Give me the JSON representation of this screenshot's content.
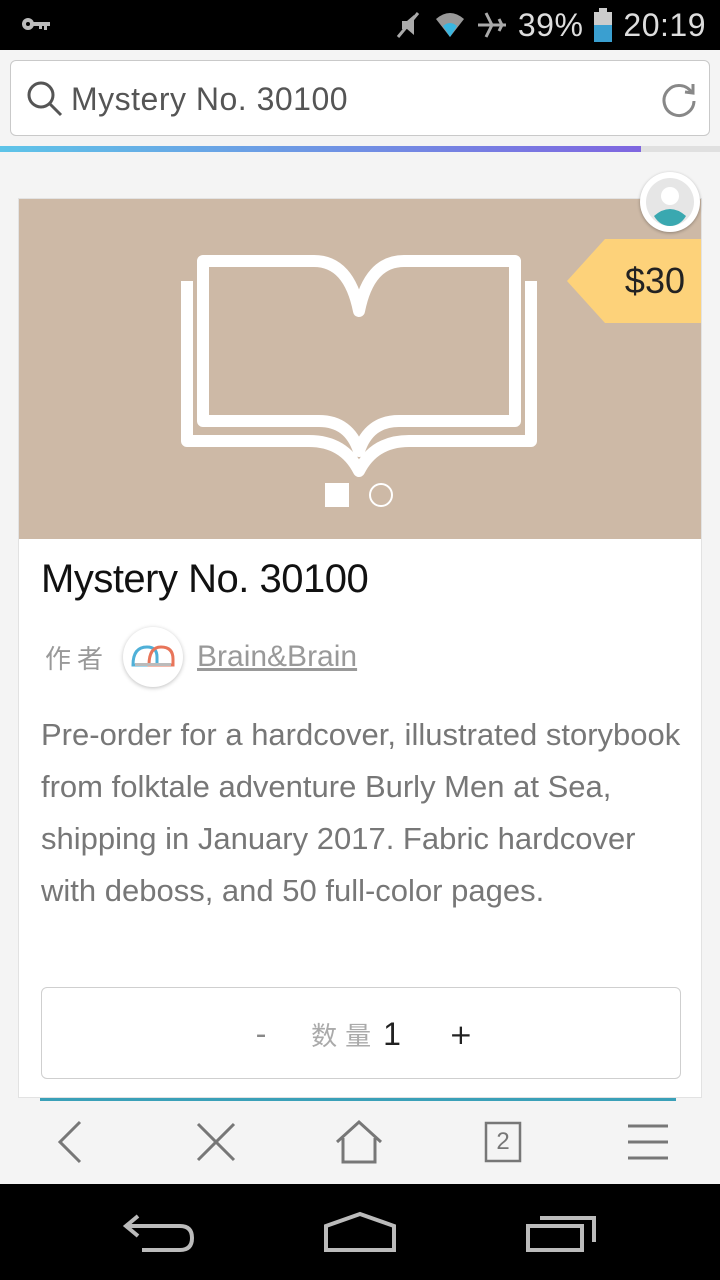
{
  "status_bar": {
    "battery_percent": "39%",
    "time": "20:19",
    "icons": [
      "key-icon",
      "mute-icon",
      "wifi-icon",
      "airplane-icon",
      "battery-icon"
    ]
  },
  "search": {
    "query": "Mystery No. 30100",
    "load_progress": 0.89,
    "gradient": [
      "#5ec4e8",
      "#7f66e0"
    ]
  },
  "product": {
    "price": "$30",
    "price_tag_color": "#fdd27a",
    "hero_color": "#cdb9a6",
    "carousel": {
      "pages": 2,
      "active_index": 0
    },
    "title": "Mystery No. 30100",
    "author_label": "作者",
    "author_name": "Brain&Brain",
    "description": "Pre-order for a hardcover, illustrated storybook from folktale adventure Burly Men at Sea, shipping in January 2017. Fabric hardcover with deboss, and 50 full-color pages.",
    "quantity": {
      "minus": "-",
      "label": "数量",
      "value": "1",
      "plus": "+"
    }
  },
  "toolbar": {
    "tabs_count": "2",
    "accent": "#3aa0b8",
    "icons": [
      "back-icon",
      "close-icon",
      "home-icon",
      "tabs-icon",
      "menu-icon"
    ]
  },
  "android_nav": {
    "icons": [
      "nav-back-icon",
      "nav-home-icon",
      "nav-recents-icon"
    ]
  }
}
